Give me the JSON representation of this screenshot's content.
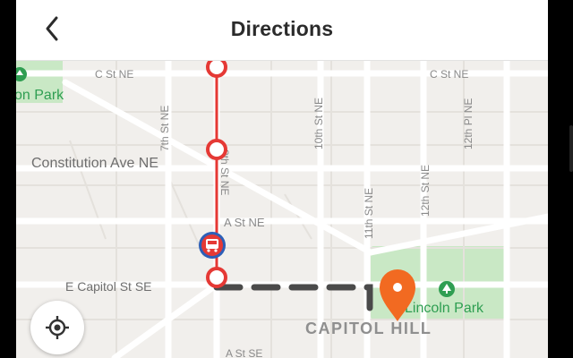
{
  "header": {
    "title": "Directions"
  },
  "map": {
    "streets": {
      "c_st_ne_left": "C St NE",
      "c_st_ne_right": "C St NE",
      "constitution_ave": "Constitution Ave NE",
      "a_st_ne": "A St NE",
      "e_capitol_st": "E Capitol St SE",
      "a_st_se": "A St SE",
      "seventh_st": "7th St NE",
      "eighth_st": "8th St NE",
      "tenth_st": "10th St NE",
      "eleventh_st": "11th St NE",
      "twelfth_st": "12th St NE",
      "twelfth_pl": "12th Pl NE"
    },
    "places": {
      "lincoln_park": "Lincoln Park",
      "park_left": "on Park",
      "neighborhood": "CAPITOL HILL"
    }
  },
  "colors": {
    "route_red": "#e53935",
    "pin_orange": "#f26a21",
    "park_green": "#c9e8c5",
    "park_text": "#2f9e52",
    "walk_dash": "#4a4a4a"
  },
  "icons": {
    "back": "chevron-left-icon",
    "bus": "bus-icon",
    "pin": "map-pin-icon",
    "park": "park-tree-icon",
    "locate": "locate-crosshair-icon"
  }
}
